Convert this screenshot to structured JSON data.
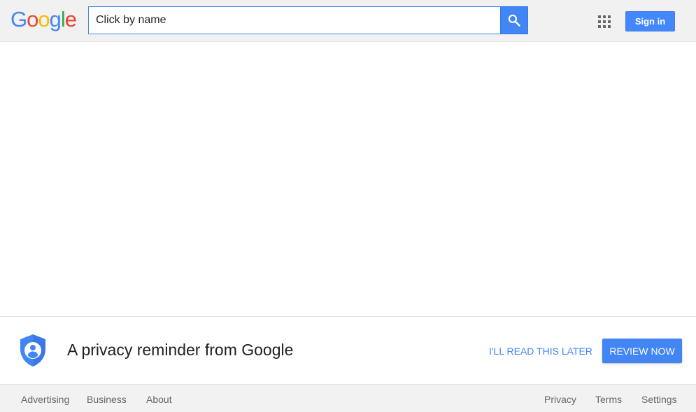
{
  "header": {
    "logo_letters": [
      "G",
      "o",
      "o",
      "g",
      "l",
      "e"
    ],
    "search": {
      "value": "Click by name"
    },
    "sign_in_label": "Sign in"
  },
  "colors": {
    "google_blue": "#4285f4",
    "google_red": "#ea4335",
    "google_yellow": "#fbbc05",
    "google_green": "#34a853"
  },
  "privacy": {
    "title": "A privacy reminder from Google",
    "read_later_label": "I'LL READ THIS LATER",
    "review_now_label": "REVIEW NOW"
  },
  "footer": {
    "left_links": [
      "Advertising",
      "Business",
      "About"
    ],
    "right_links": [
      "Privacy",
      "Terms",
      "Settings"
    ]
  },
  "icons": {
    "search": "search-icon",
    "apps": "apps-grid-icon",
    "shield": "privacy-shield-icon"
  }
}
